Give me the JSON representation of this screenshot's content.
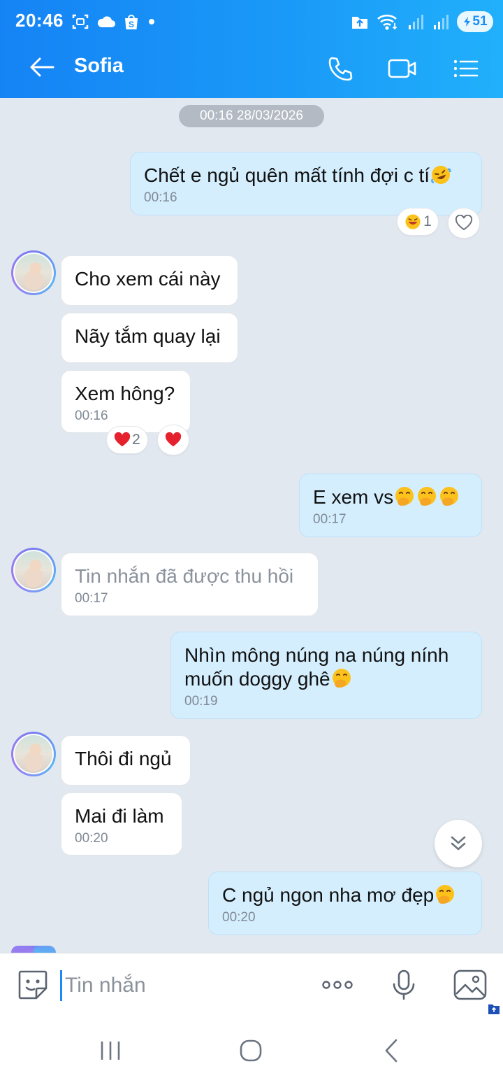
{
  "status_bar": {
    "time": "20:46",
    "battery": "51",
    "left_icons": [
      "screenshot-icon",
      "cloud-icon",
      "shopee-icon",
      "dot-icon"
    ],
    "right_icons": [
      "upload-icon",
      "wifi-icon",
      "signal-icon",
      "signal-icon"
    ]
  },
  "header": {
    "contact_name": "Sofia",
    "accent": "#1a8ef8"
  },
  "chat": {
    "date_divider": "00:16 28/03/2026",
    "messages": [
      {
        "dir": "out",
        "text": "Chết e ngủ quên mất tính đợi c tí",
        "emoji": "rofl",
        "time": "00:16",
        "reaction_count": "1"
      },
      {
        "dir": "in",
        "text": "Cho xem cái này"
      },
      {
        "dir": "in",
        "text": "Nãy tắm quay lại"
      },
      {
        "dir": "in",
        "text": "Xem hông?",
        "time": "00:16",
        "reaction_count": "2"
      },
      {
        "dir": "out",
        "text": "E xem vs",
        "emoji": "hand-over-mouth x3",
        "time": "00:17"
      },
      {
        "dir": "in",
        "text": "Tin nhắn đã được thu hồi",
        "time": "00:17",
        "recalled": true
      },
      {
        "dir": "out",
        "text": "Nhìn mông núng na núng nính\nmuốn doggy ghê",
        "emoji": "hand-over-mouth",
        "time": "00:19"
      },
      {
        "dir": "in",
        "text": "Thôi đi ngủ"
      },
      {
        "dir": "in",
        "text": "Mai đi làm",
        "time": "00:20"
      },
      {
        "dir": "out",
        "text": "C ngủ ngon nha mơ đẹp",
        "emoji": "hand-over-mouth",
        "time": "00:20"
      }
    ]
  },
  "input": {
    "placeholder": "Tin nhắn"
  }
}
